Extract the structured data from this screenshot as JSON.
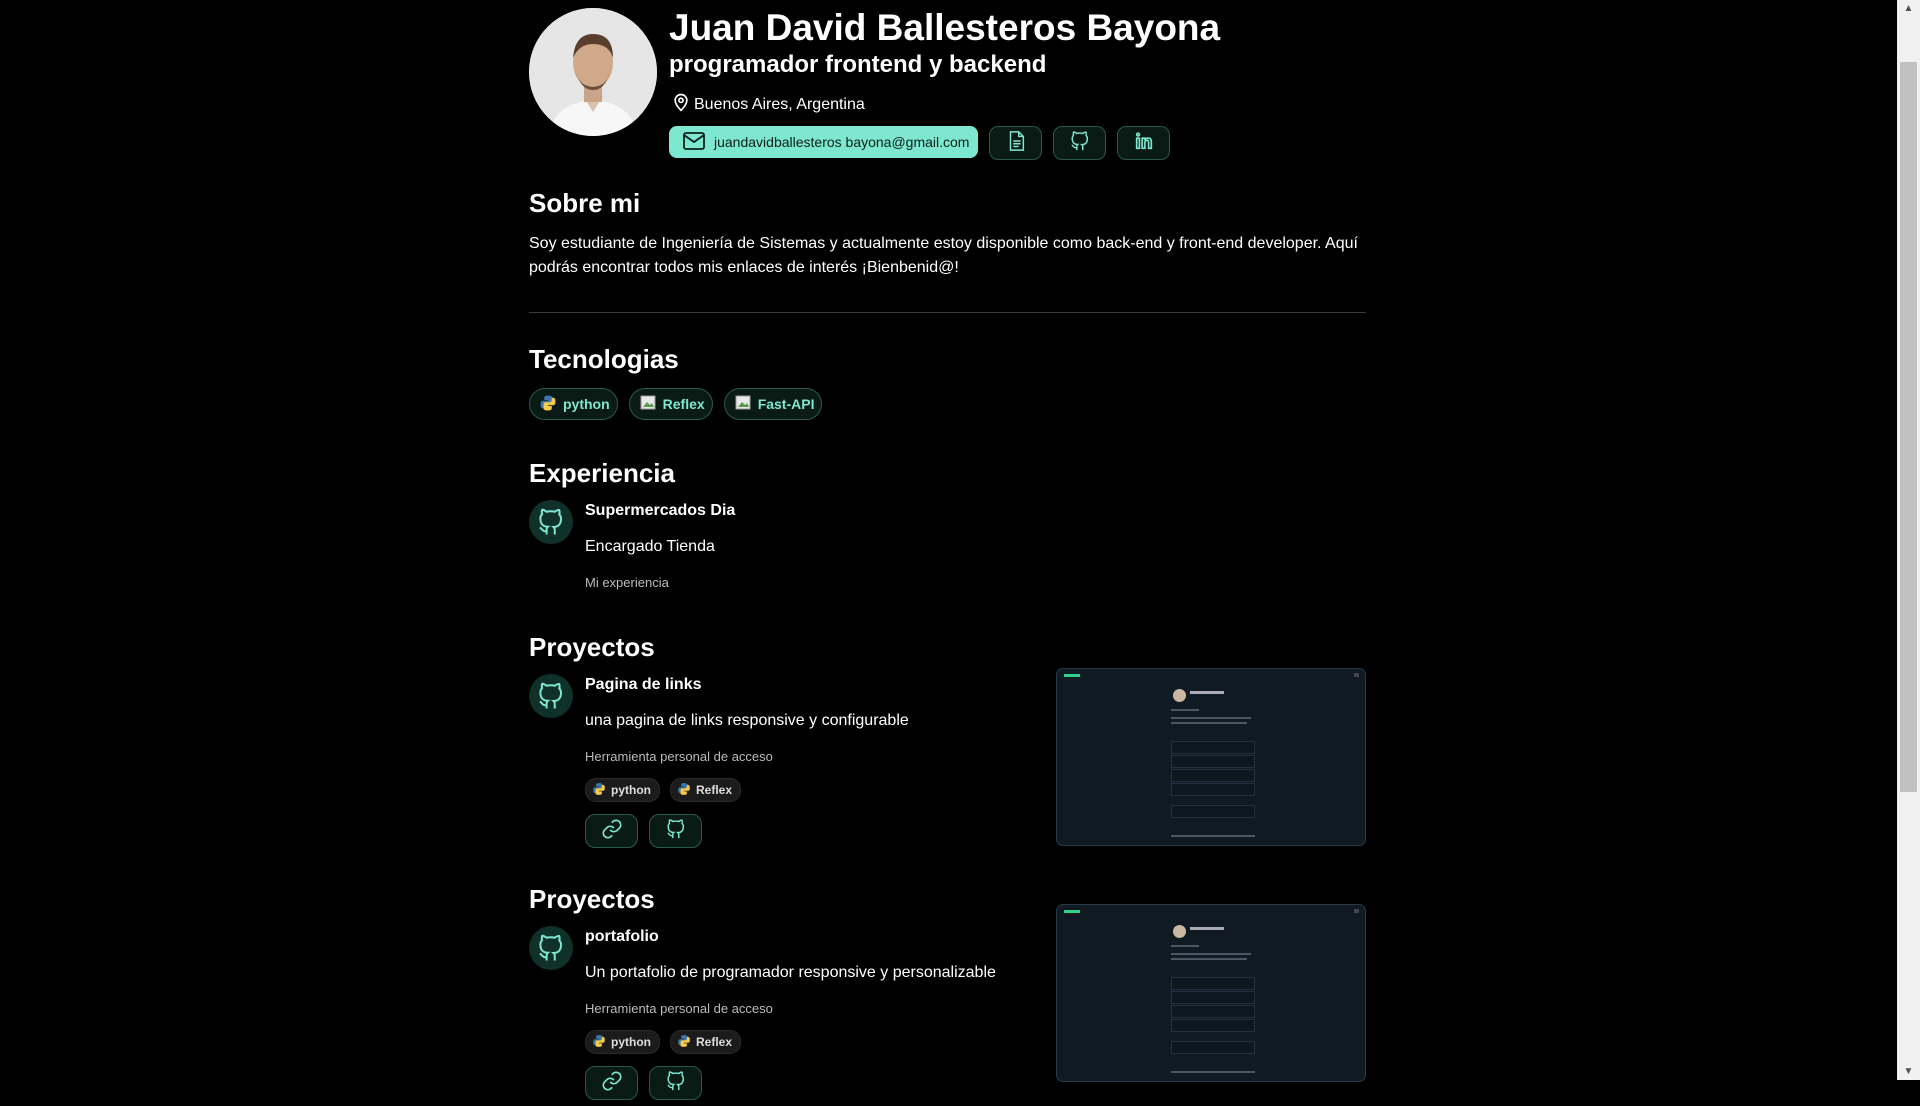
{
  "profile": {
    "name": "Juan David Ballesteros Bayona",
    "role": "programador frontend y backend",
    "location": "Buenos Aires, Argentina",
    "email": "juandavidballesteros bayona@gmail.com"
  },
  "about": {
    "heading": "Sobre mi",
    "text": "Soy estudiante de Ingeniería de Sistemas y actualmente estoy disponible como back-end y front-end developer. Aquí podrás encontrar todos mis enlaces de interés ¡Bienbenid@!"
  },
  "tech": {
    "heading": "Tecnologias",
    "items": [
      "python",
      "Reflex",
      "Fast-API"
    ]
  },
  "experience": {
    "heading": "Experiencia",
    "company": "Supermercados Dia",
    "position": "Encargado Tienda",
    "description": "Mi experiencia"
  },
  "projects": [
    {
      "heading": "Proyectos",
      "title": "Pagina de links",
      "description": "una pagina de links responsive y configurable",
      "meta": "Herramienta personal de acceso",
      "tags": [
        "python",
        "Reflex"
      ]
    },
    {
      "heading": "Proyectos",
      "title": "portafolio",
      "description": "Un portafolio de programador responsive y personalizable",
      "meta": "Herramienta personal de acceso",
      "tags": [
        "python",
        "Reflex"
      ]
    }
  ],
  "thumbnail": {
    "name_text": "Juan Ballesteros"
  },
  "colors": {
    "background": "#000000",
    "accent": "#7de8cf",
    "pill_bg": "#0a1a15"
  },
  "icons": {
    "location": "map-pin-icon",
    "email": "mail-icon",
    "cv": "document-icon",
    "github": "github-icon",
    "linkedin": "linkedin-icon",
    "link": "link-icon",
    "python": "python-logo-icon"
  }
}
